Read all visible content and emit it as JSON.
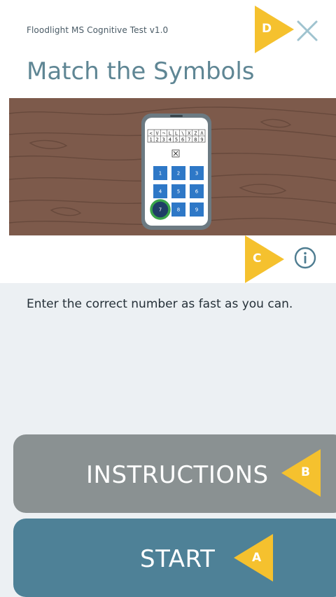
{
  "header": {
    "app_title": "Floodlight MS Cognitive Test v1.0",
    "page_title": "Match the Symbols",
    "close_icon": "close-icon"
  },
  "hero": {
    "key_symbols": [
      "<",
      "V",
      "¬",
      "L",
      "L",
      "\\",
      "X",
      "Z",
      "Λ"
    ],
    "key_numbers": [
      "1",
      "2",
      "3",
      "4",
      "5",
      "6",
      "7",
      "8",
      "9"
    ],
    "target_symbol": "⊠",
    "keypad": [
      "1",
      "2",
      "3",
      "4",
      "5",
      "6",
      "7",
      "8",
      "9"
    ],
    "highlighted_key": "7"
  },
  "info": {
    "icon": "info-icon"
  },
  "content": {
    "instruction": "Enter the correct number as fast as you can."
  },
  "buttons": {
    "instructions_label": "INSTRUCTIONS",
    "start_label": "START"
  },
  "badges": {
    "a": "A",
    "b": "B",
    "c": "C",
    "d": "D"
  },
  "colors": {
    "title": "#5f8694",
    "instructions_button": "#8a9192",
    "start_button": "#4e8197",
    "content_bg": "#ecf0f3",
    "badge": "#f5c12e",
    "keypad_key": "#2e78c7",
    "highlight_ring": "#3aa54a",
    "wood": "#7d5a4b"
  }
}
